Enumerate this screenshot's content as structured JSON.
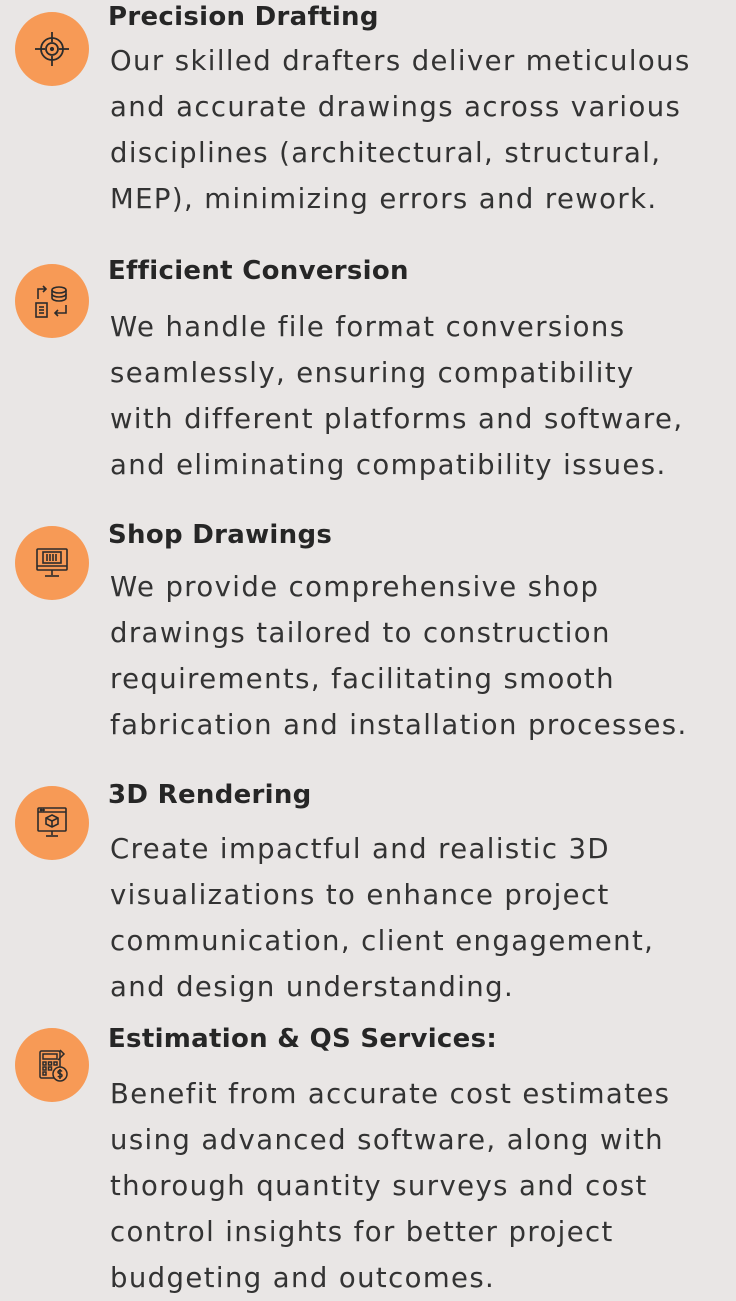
{
  "services": [
    {
      "icon": "crosshair-icon",
      "title": "Precision Drafting",
      "description": "Our skilled drafters deliver meticulous\nand accurate drawings across various\ndisciplines (architectural, structural,\nMEP), minimizing errors and rework."
    },
    {
      "icon": "file-conversion-icon",
      "title": "Efficient Conversion",
      "description": "We handle file format conversions\nseamlessly, ensuring compatibility\nwith different platforms and software,\nand eliminating compatibility issues."
    },
    {
      "icon": "monitor-blueprint-icon",
      "title": "Shop Drawings",
      "description": "We provide comprehensive shop\ndrawings tailored to construction\nrequirements, facilitating smooth\nfabrication and installation processes."
    },
    {
      "icon": "monitor-3d-cube-icon",
      "title": "3D Rendering",
      "description": "Create impactful and realistic 3D\nvisualizations to enhance project\ncommunication, client engagement,\nand design understanding."
    },
    {
      "icon": "calculator-dollar-icon",
      "title": "Estimation & QS Services:",
      "description": "Benefit from accurate cost estimates\nusing advanced software, along with\nthorough quantity surveys and cost\ncontrol insights for better project\nbudgeting and outcomes."
    }
  ],
  "colors": {
    "background": "#e9e6e5",
    "icon_circle": "#f79a56",
    "icon_stroke": "#2b2b2b",
    "text": "#333333"
  }
}
